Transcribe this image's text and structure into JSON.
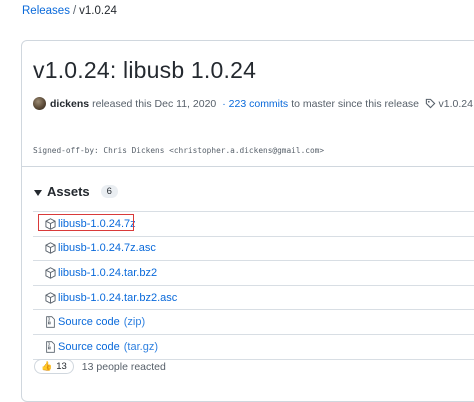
{
  "breadcrumb": {
    "parent": "Releases",
    "separator": "/",
    "current": "v1.0.24"
  },
  "release": {
    "title": "v1.0.24: libusb 1.0.24",
    "author": "dickens",
    "released_text": "released this Dec 11, 2020",
    "commits_link": "· 223 commits",
    "commits_suffix": "to master since this release",
    "tag": "v1.0.24",
    "signoff": "Signed-off-by: Chris Dickens <christopher.a.dickens@gmail.com>"
  },
  "assets": {
    "heading": "Assets",
    "count": "6",
    "items": [
      {
        "name": "libusb-1.0.24.7z",
        "suffix": "",
        "icon": "package-icon"
      },
      {
        "name": "libusb-1.0.24.7z.asc",
        "suffix": "",
        "icon": "package-icon"
      },
      {
        "name": "libusb-1.0.24.tar.bz2",
        "suffix": "",
        "icon": "package-icon"
      },
      {
        "name": "libusb-1.0.24.tar.bz2.asc",
        "suffix": "",
        "icon": "package-icon"
      },
      {
        "name": "Source code",
        "suffix": "(zip)",
        "icon": "file-zip-icon"
      },
      {
        "name": "Source code",
        "suffix": "(tar.gz)",
        "icon": "file-zip-icon"
      }
    ]
  },
  "reactions": {
    "emoji": "👍",
    "count": "13",
    "summary": "13 people reacted"
  },
  "colors": {
    "link": "#0969da",
    "highlight_border": "#d93a3a"
  }
}
